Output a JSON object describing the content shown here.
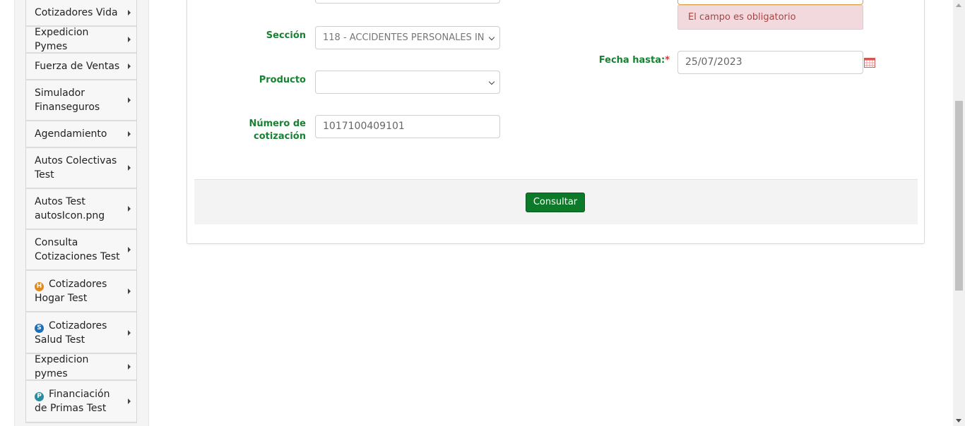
{
  "sidebar": {
    "items": [
      {
        "label": "Cotizadores Vida",
        "icon": "",
        "icon_color": "",
        "icon_glyph": ""
      },
      {
        "label": "Expedicion Pymes",
        "icon": "",
        "icon_color": "",
        "icon_glyph": ""
      },
      {
        "label": "Fuerza de Ventas",
        "icon": "",
        "icon_color": "",
        "icon_glyph": ""
      },
      {
        "label": "Simulador Finanseguros",
        "icon": "",
        "icon_color": "",
        "icon_glyph": ""
      },
      {
        "label": "Agendamiento",
        "icon": "",
        "icon_color": "",
        "icon_glyph": ""
      },
      {
        "label": "Autos Colectivas Test",
        "icon": "",
        "icon_color": "",
        "icon_glyph": ""
      },
      {
        "label": "Autos Test autosIcon.png",
        "icon": "",
        "icon_color": "",
        "icon_glyph": ""
      },
      {
        "label": "Consulta Cotizaciones Test",
        "icon": "",
        "icon_color": "",
        "icon_glyph": ""
      },
      {
        "label": "Cotizadores Hogar Test",
        "icon": "home-badge-icon",
        "icon_color": "#e08a1e",
        "icon_glyph": "H"
      },
      {
        "label": "Cotizadores Salud Test",
        "icon": "health-badge-icon",
        "icon_color": "#1e6fb5",
        "icon_glyph": "S"
      },
      {
        "label": "Expedicion pymes",
        "icon": "",
        "icon_color": "",
        "icon_glyph": ""
      },
      {
        "label": "Financiación de Primas Test",
        "icon": "finance-badge-icon",
        "icon_color": "#2a8c9a",
        "icon_glyph": "P"
      }
    ]
  },
  "form": {
    "seccion_label": "Sección",
    "seccion_value": "118 - ACCIDENTES PERSONALES IN",
    "producto_label": "Producto",
    "producto_value": "",
    "numero_label": "Número de cotización",
    "numero_value": "1017100409101",
    "fecha_hasta_label": "Fecha hasta:",
    "fecha_hasta_required": "*",
    "fecha_hasta_value": "25/07/2023",
    "error_message": "El campo es obligatorio",
    "submit_label": "Consultar"
  },
  "colors": {
    "accent_green": "#168232",
    "button_green": "#0d7a29",
    "error_bg": "#f2d9de",
    "error_text": "#a94442"
  }
}
